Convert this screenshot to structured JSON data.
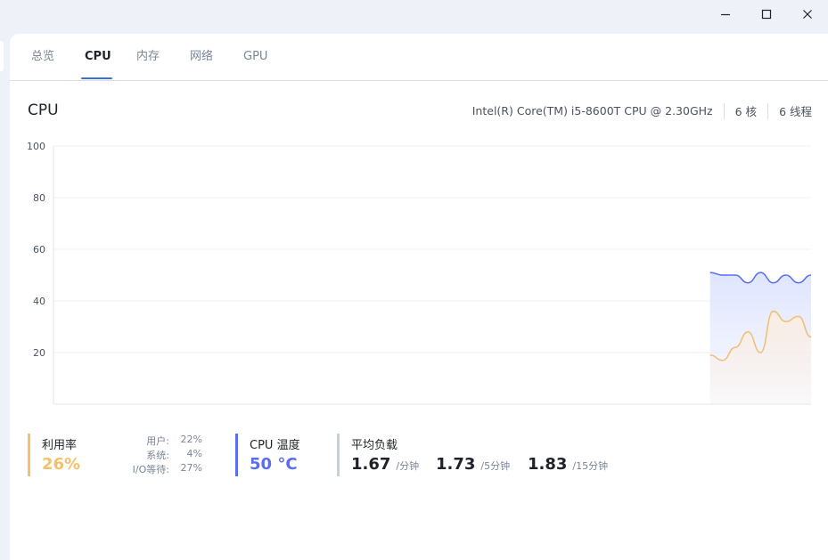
{
  "tabs": [
    {
      "label": "总览",
      "active": false
    },
    {
      "label": "CPU",
      "active": true
    },
    {
      "label": "内存",
      "active": false
    },
    {
      "label": "网络",
      "active": false
    },
    {
      "label": "GPU",
      "active": false
    }
  ],
  "section": {
    "title": "CPU",
    "model": "Intel(R) Core(TM) i5-8600T CPU @ 2.30GHz",
    "cores": "6 核",
    "threads": "6 线程"
  },
  "chart_data": {
    "type": "area",
    "y_ticks": [
      "100",
      "80",
      "60",
      "40",
      "20"
    ],
    "ylim": [
      0,
      100
    ],
    "grid": true,
    "x_count": 61,
    "series": [
      {
        "color": "#5a6df0",
        "fill": "#dfe5fd",
        "x": [
          52,
          53,
          54,
          55,
          56,
          57,
          58,
          59,
          60
        ],
        "values": [
          51,
          50,
          50,
          47,
          51,
          47,
          50,
          47,
          50
        ]
      },
      {
        "color": "#f0bd72",
        "fill": "#fbeee3",
        "x": [
          52,
          53,
          54,
          55,
          56,
          57,
          58,
          59,
          60
        ],
        "values": [
          19,
          17,
          22,
          28,
          20,
          36,
          32,
          34,
          26
        ]
      }
    ]
  },
  "usage": {
    "label": "利用率",
    "value": "26%",
    "color": "#f3c06b",
    "rows": [
      {
        "k": "用户:",
        "v": "22%"
      },
      {
        "k": "系统:",
        "v": "4%"
      },
      {
        "k": "I/O等待:",
        "v": "27%"
      }
    ]
  },
  "temperature": {
    "label": "CPU 温度",
    "value": "50 °C",
    "color": "#5a6df0"
  },
  "load": {
    "label": "平均负载",
    "items": [
      {
        "num": "1.67",
        "unit": "/分钟"
      },
      {
        "num": "1.73",
        "unit": "/5分钟"
      },
      {
        "num": "1.83",
        "unit": "/15分钟"
      }
    ]
  }
}
